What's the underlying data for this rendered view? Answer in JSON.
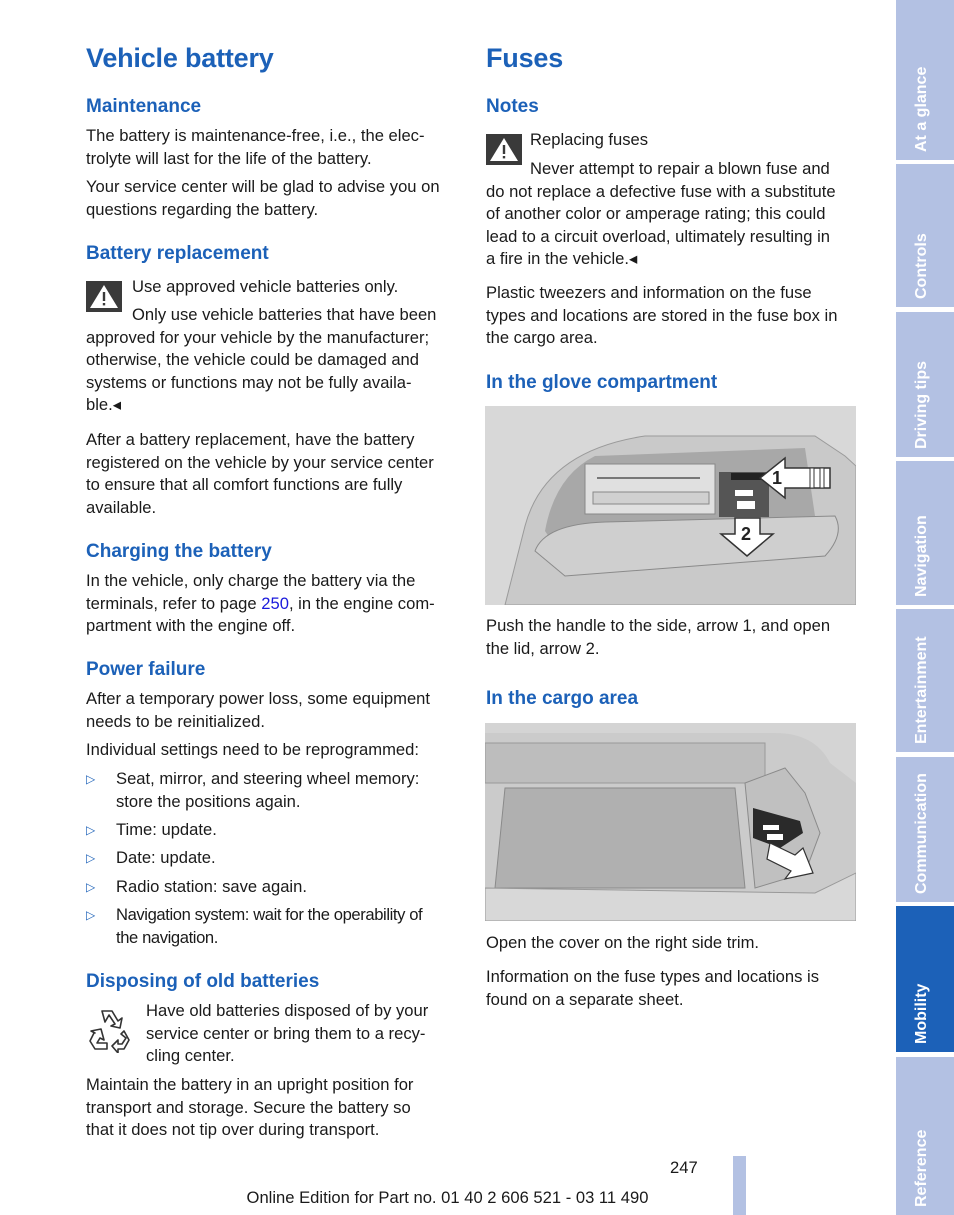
{
  "left_column": {
    "title": "Vehicle battery",
    "maintenance": {
      "heading": "Maintenance",
      "p1": [
        "The battery is maintenance-free, i.e., the elec-",
        "trolyte will last for the life of the battery."
      ],
      "p2": [
        "Your service center will be glad to advise you on",
        "questions regarding the battery."
      ]
    },
    "battery_replacement": {
      "heading": "Battery replacement",
      "warning_title": "Use approved vehicle batteries only.",
      "warning_lines": [
        "Only use vehicle batteries that have been",
        "approved for your vehicle by the manufacturer;",
        "otherwise, the vehicle could be damaged and",
        "systems or functions may not be fully availa-",
        "ble.◂"
      ],
      "p1": [
        "After a battery replacement, have the battery",
        "registered on the vehicle by your service center",
        "to ensure that all comfort functions are fully",
        "available."
      ]
    },
    "charging": {
      "heading": "Charging the battery",
      "line1": "In the vehicle, only charge the battery via the",
      "line2_before": "terminals, refer to page ",
      "line2_link": "250",
      "line2_after": ", in the engine com-",
      "line3": "partment with the engine off."
    },
    "power_failure": {
      "heading": "Power failure",
      "p1": [
        "After a temporary power loss, some equipment",
        "needs to be reinitialized."
      ],
      "p2": "Individual settings need to be reprogrammed:",
      "bullet_marker": "▷",
      "bullets": [
        [
          "Seat, mirror, and steering wheel memory:",
          "store the positions again."
        ],
        [
          "Time: update."
        ],
        [
          "Date: update."
        ],
        [
          "Radio station: save again."
        ],
        [
          "Navigation system: wait for the operability of",
          "the navigation."
        ]
      ]
    },
    "disposing": {
      "heading": "Disposing of old batteries",
      "note_lines": [
        "Have old batteries disposed of by your",
        "service center or bring them to a recy-",
        "cling center."
      ],
      "p1": [
        "Maintain the battery in an upright position for",
        "transport and storage. Secure the battery so",
        "that it does not tip over during transport."
      ]
    }
  },
  "right_column": {
    "title": "Fuses",
    "notes": {
      "heading": "Notes",
      "warning_title": "Replacing fuses",
      "warning_lines": [
        "Never attempt to repair a blown fuse and",
        "do not replace a defective fuse with a substitute",
        "of another color or amperage rating; this could",
        "lead to a circuit overload, ultimately resulting in",
        "a fire in the vehicle.◂"
      ],
      "p1": [
        "Plastic tweezers and information on the fuse",
        "types and locations are stored in the fuse box in",
        "the cargo area."
      ]
    },
    "glove": {
      "heading": "In the glove compartment",
      "figure_arrow1": "1",
      "figure_arrow2": "2",
      "caption": [
        "Push the handle to the side, arrow 1, and open",
        "the lid, arrow 2."
      ]
    },
    "cargo": {
      "heading": "In the cargo area",
      "caption": "Open the cover on the right side trim.",
      "p1": [
        "Information on the fuse types and locations is",
        "found on a separate sheet."
      ]
    }
  },
  "tabs": [
    {
      "label": "At a glance",
      "active": false
    },
    {
      "label": "Controls",
      "active": false
    },
    {
      "label": "Driving tips",
      "active": false
    },
    {
      "label": "Navigation",
      "active": false
    },
    {
      "label": "Entertainment",
      "active": false
    },
    {
      "label": "Communication",
      "active": false
    },
    {
      "label": "Mobility",
      "active": true
    },
    {
      "label": "Reference",
      "active": false
    }
  ],
  "page_number": "247",
  "footer": "Online Edition for Part no. 01 40 2 606 521 - 03 11 490",
  "colors": {
    "heading": "#1c61b8",
    "tab_inactive": "#b3c1e3",
    "tab_active": "#1c61b8",
    "link": "#1a1adc"
  }
}
